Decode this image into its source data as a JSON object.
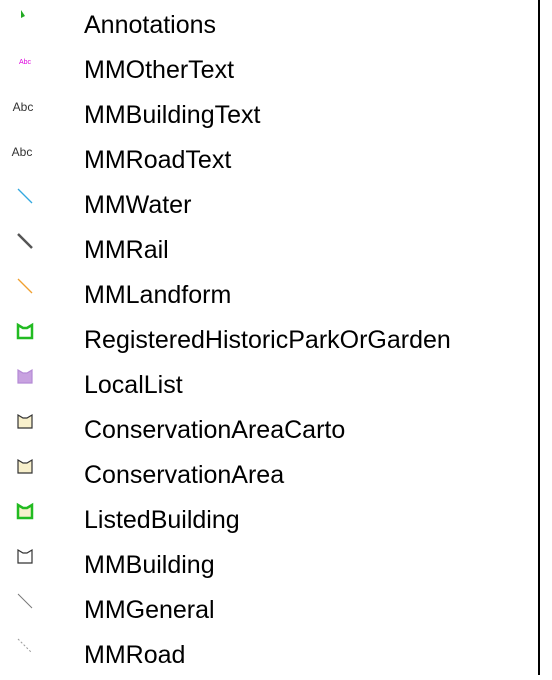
{
  "legend": {
    "items": [
      {
        "label": "Annotations",
        "icon": "annotation-marker-icon",
        "color": "#22aa22"
      },
      {
        "label": "MMOtherText",
        "icon": "text-sample-icon",
        "text_sample": "Abc",
        "color": "#dd00dd"
      },
      {
        "label": "MMBuildingText",
        "icon": "text-sample-icon",
        "text_sample": "Abc",
        "color": "#333333"
      },
      {
        "label": "MMRoadText",
        "icon": "text-sample-icon",
        "text_sample": "Abc",
        "color": "#333333"
      },
      {
        "label": "MMWater",
        "icon": "line-symbol-icon",
        "color": "#33a8e0"
      },
      {
        "label": "MMRail",
        "icon": "line-symbol-icon",
        "color": "#555555"
      },
      {
        "label": "MMLandform",
        "icon": "line-symbol-icon",
        "color": "#f0a030"
      },
      {
        "label": "RegisteredHistoricParkOrGarden",
        "icon": "polygon-symbol-icon",
        "color": "#22bb22"
      },
      {
        "label": "LocalList",
        "icon": "polygon-symbol-icon",
        "color": "#c8a2e0"
      },
      {
        "label": "ConservationAreaCarto",
        "icon": "polygon-symbol-icon",
        "color": "#333333"
      },
      {
        "label": "ConservationArea",
        "icon": "polygon-symbol-icon",
        "color": "#333333"
      },
      {
        "label": "ListedBuilding",
        "icon": "polygon-symbol-icon",
        "color": "#22bb22"
      },
      {
        "label": "MMBuilding",
        "icon": "polygon-symbol-icon",
        "color": "#333333"
      },
      {
        "label": "MMGeneral",
        "icon": "line-symbol-icon",
        "color": "#777777"
      },
      {
        "label": "MMRoad",
        "icon": "line-symbol-icon",
        "color": "#999999"
      }
    ]
  }
}
